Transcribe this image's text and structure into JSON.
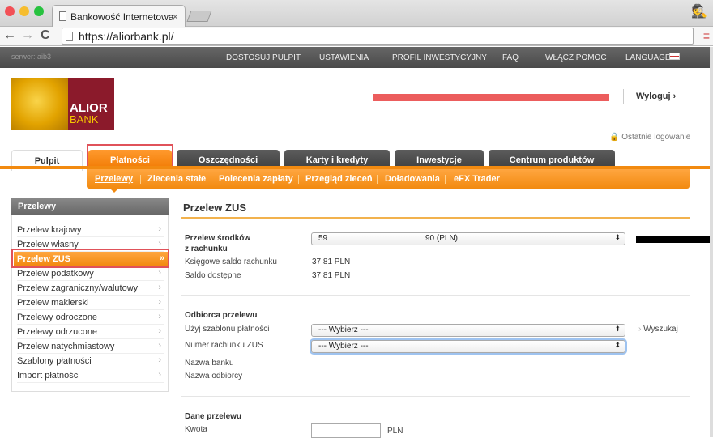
{
  "browser": {
    "tab_title": "Bankowość Internetowa",
    "tab_close": "×",
    "url": "https://aliorbank.pl/",
    "back_icon": "←",
    "forward_icon": "→",
    "reload_icon": "C",
    "menu_icon": "≡"
  },
  "topbar": {
    "server": "serwer: aib3",
    "links": [
      "DOSTOSUJ PULPIT",
      "USTAWIENIA",
      "PROFIL INWESTYCYJNY",
      "FAQ",
      "WŁĄCZ POMOC",
      "LANGUAGE"
    ]
  },
  "logo": {
    "alior": "ALIOR",
    "bank": "BANK"
  },
  "header": {
    "logout": "Wyloguj",
    "logout_arrow": "›",
    "last_login": "Ostatnie logowanie"
  },
  "main_tabs": [
    "Pulpit",
    "Płatności",
    "Oszczędności",
    "Karty i kredyty",
    "Inwestycje",
    "Centrum produktów"
  ],
  "sub_tabs": [
    "Przelewy",
    "Zlecenia stałe",
    "Polecenia zapłaty",
    "Przegląd zleceń",
    "Doładowania",
    "eFX Trader"
  ],
  "sidebar": {
    "title": "Przelewy",
    "items": [
      "Przelew krajowy",
      "Przelew własny",
      "Przelew ZUS",
      "Przelew podatkowy",
      "Przelew zagraniczny/walutowy",
      "Przelew maklerski",
      "Przelewy odroczone",
      "Przelewy odrzucone",
      "Przelew natychmiastowy",
      "Szablony płatności",
      "Import płatności"
    ],
    "chevron": "›",
    "active_chevron": "»"
  },
  "content": {
    "title": "Przelew ZUS",
    "source_label_1": "Przelew środków",
    "source_label_2": "z rachunku",
    "account_prefix": "59",
    "account_suffix": "90   (PLN)",
    "book_balance_label": "Księgowe saldo rachunku",
    "book_balance": "37,81 PLN",
    "available_label": "Saldo dostępne",
    "available": "37,81 PLN",
    "recipient_header": "Odbiorca przelewu",
    "template_label": "Użyj szablonu płatności",
    "template_value": "--- Wybierz ---",
    "search": "Wyszukaj",
    "zus_account_label": "Numer rachunku ZUS",
    "zus_account_value": "--- Wybierz ---",
    "bank_name_label": "Nazwa banku",
    "recipient_name_label": "Nazwa odbiorcy",
    "details_header": "Dane przelewu",
    "amount_label": "Kwota",
    "currency": "PLN"
  },
  "colors": {
    "accent": "#f28a10",
    "brand": "#8b1a2b",
    "highlight": "#e0525a"
  }
}
